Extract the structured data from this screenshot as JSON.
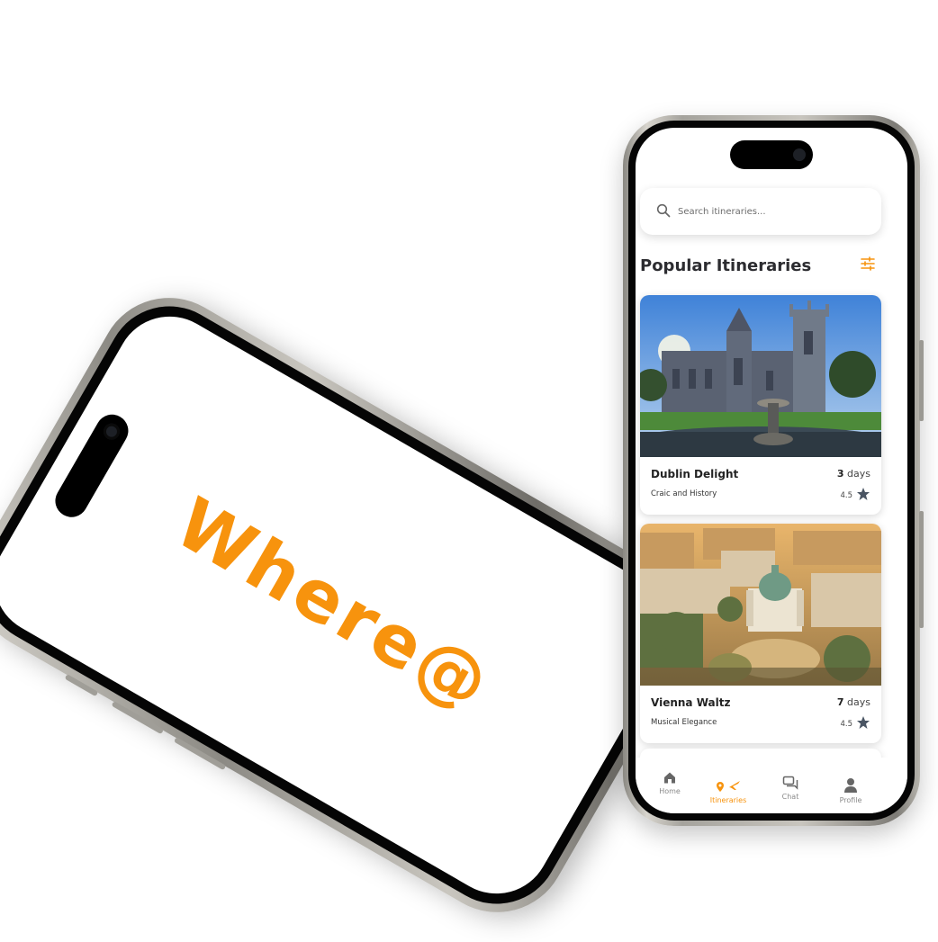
{
  "splash": {
    "logo_text": "Where@"
  },
  "app": {
    "search": {
      "placeholder": "Search itineraries..."
    },
    "section_title": "Popular Itineraries",
    "cards": [
      {
        "title": "Dublin Delight",
        "subtitle": "Craic and History",
        "days_value": "3",
        "days_unit": "days",
        "rating": "4.5"
      },
      {
        "title": "Vienna Waltz",
        "subtitle": "Musical Elegance",
        "days_value": "7",
        "days_unit": "days",
        "rating": "4.5"
      }
    ],
    "nav": [
      {
        "label": "Home",
        "icon": "home-icon",
        "active": false
      },
      {
        "label": "Itineraries",
        "icon": "itineraries-icon",
        "active": true
      },
      {
        "label": "Chat",
        "icon": "chat-icon",
        "active": false
      },
      {
        "label": "Profile",
        "icon": "profile-icon",
        "active": false
      }
    ]
  },
  "colors": {
    "accent": "#f7930d",
    "title_text": "#2c2c30",
    "inactive_nav": "#8a8a8a",
    "star": "#4a5563"
  }
}
